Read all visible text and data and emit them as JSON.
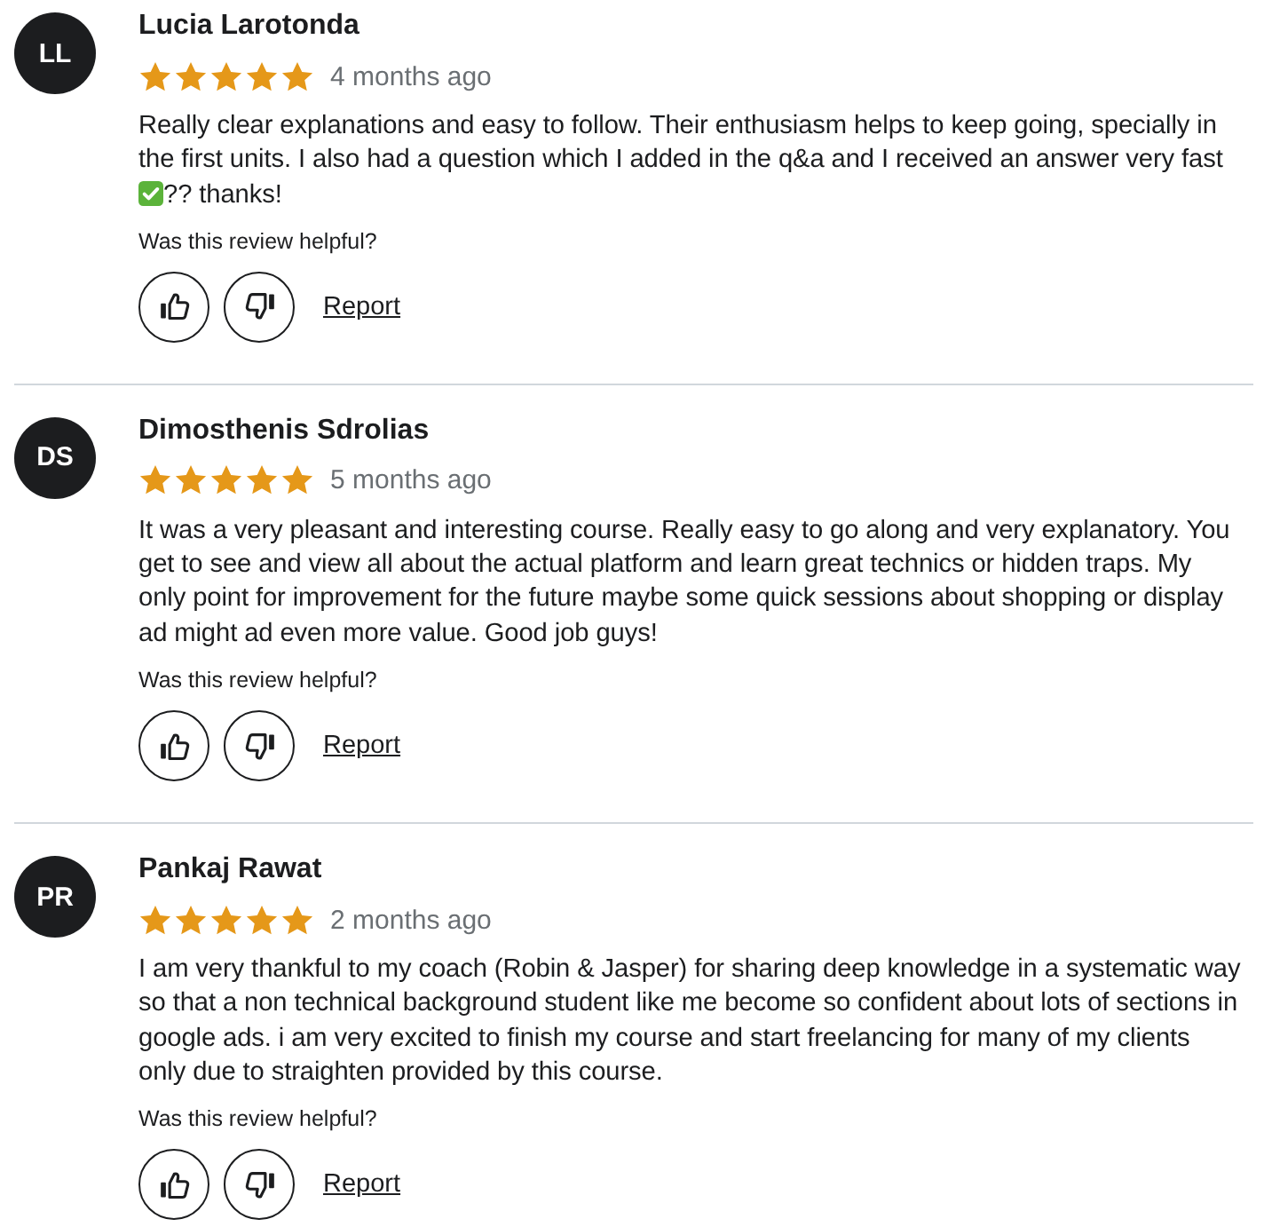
{
  "reviews": [
    {
      "initials": "LL",
      "name": "Lucia Larotonda",
      "stars": 5,
      "time": "4 months ago",
      "body": [
        {
          "kind": "text",
          "text": "Really clear explanations and easy to follow. Their enthusiasm helps to keep going, specially in the first units. I also had a question which I added in the q&a and I received an answer very fast "
        },
        {
          "kind": "check-emoji"
        },
        {
          "kind": "text",
          "text": "?? thanks!"
        }
      ],
      "helpful_prompt": "Was this review helpful?",
      "report": "Report"
    },
    {
      "initials": "DS",
      "name": "Dimosthenis Sdrolias",
      "stars": 5,
      "time": "5 months ago",
      "body": [
        {
          "kind": "text",
          "text": "It was a very pleasant and interesting course. Really easy to go along and very explanatory. You get to see and view all about the actual platform and learn great technics or hidden traps. My only point for improvement for the future maybe some quick sessions about shopping or display ad might ad even more value. Good job guys!"
        }
      ],
      "helpful_prompt": "Was this review helpful?",
      "report": "Report"
    },
    {
      "initials": "PR",
      "name": "Pankaj Rawat",
      "stars": 5,
      "time": "2 months ago",
      "body": [
        {
          "kind": "text",
          "text": "I am very thankful to my coach (Robin & Jasper) for sharing deep knowledge in a systematic way so that a non technical background student like me become so confident about lots of sections in google ads. i am very excited to finish my course and start freelancing for many of my clients only due to straighten provided by this course."
        }
      ],
      "helpful_prompt": "Was this review helpful?",
      "report": "Report"
    }
  ]
}
